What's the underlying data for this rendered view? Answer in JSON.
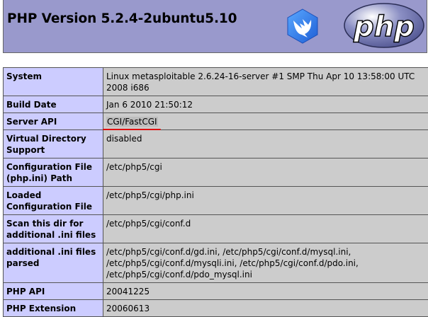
{
  "header": {
    "title": "PHP Version 5.2.4-2ubuntu5.10",
    "logo_text": "php"
  },
  "rows": [
    {
      "label": "System",
      "value": "Linux metasploitable 2.6.24-16-server #1 SMP Thu Apr 10 13:58:00 UTC 2008 i686"
    },
    {
      "label": "Build Date",
      "value": "Jan 6 2010 21:50:12"
    },
    {
      "label": "Server API",
      "value": "CGI/FastCGI"
    },
    {
      "label": "Virtual Directory Support",
      "value": "disabled"
    },
    {
      "label": "Configuration File (php.ini) Path",
      "value": "/etc/php5/cgi"
    },
    {
      "label": "Loaded Configuration File",
      "value": "/etc/php5/cgi/php.ini"
    },
    {
      "label": "Scan this dir for additional .ini files",
      "value": "/etc/php5/cgi/conf.d"
    },
    {
      "label": "additional .ini files parsed",
      "value": "/etc/php5/cgi/conf.d/gd.ini, /etc/php5/cgi/conf.d/mysql.ini, /etc/php5/cgi/conf.d/mysqli.ini, /etc/php5/cgi/conf.d/pdo.ini, /etc/php5/cgi/conf.d/pdo_mysql.ini"
    },
    {
      "label": "PHP API",
      "value": "20041225"
    },
    {
      "label": "PHP Extension",
      "value": "20060613"
    }
  ],
  "icons": {
    "app_logo": "bird-shield-icon",
    "php_logo": "php-logo-icon"
  },
  "colors": {
    "header_bg": "#9999cc",
    "label_cell_bg": "#ccccff",
    "value_cell_bg": "#cccccc",
    "annotation_underline": "#e01010"
  }
}
